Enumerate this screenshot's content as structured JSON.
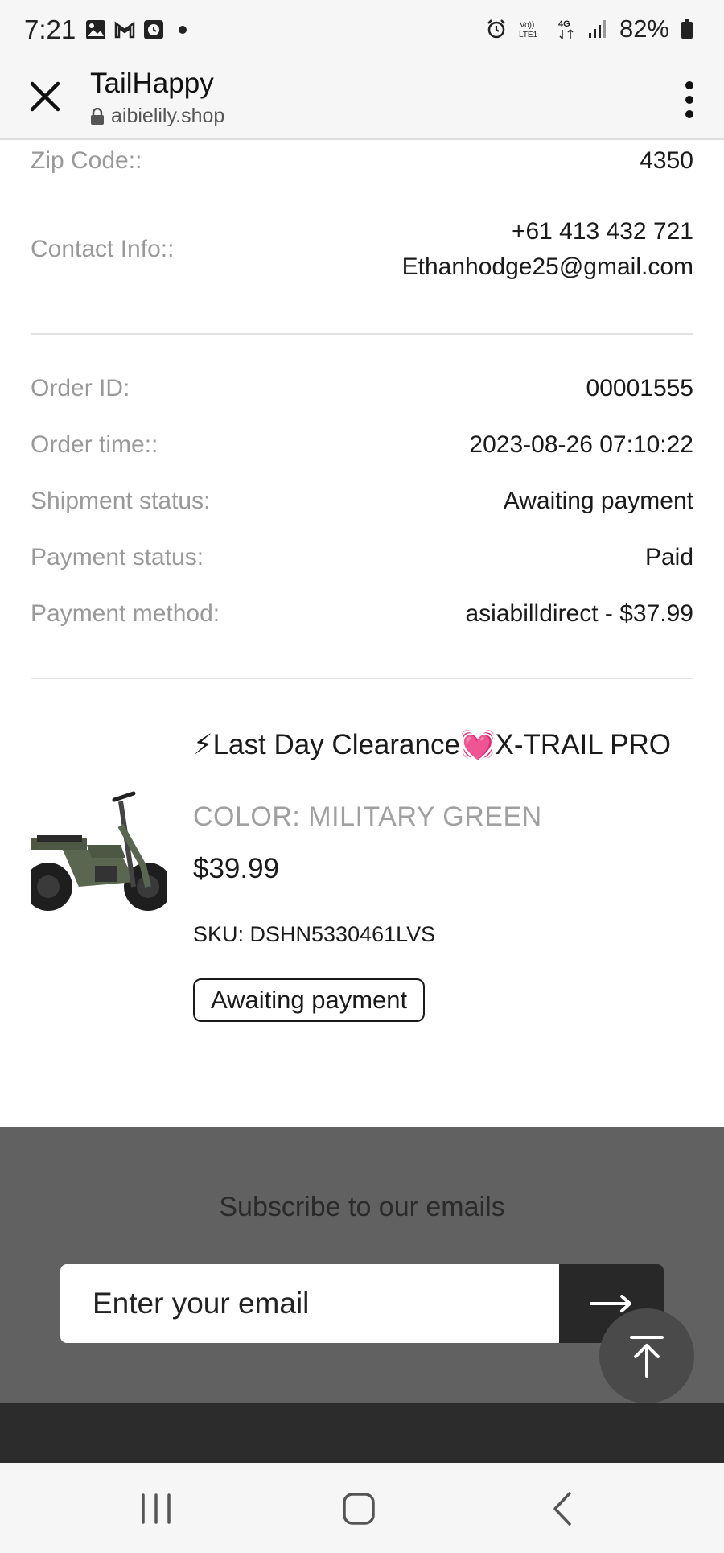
{
  "status_bar": {
    "time": "7:21",
    "battery": "82%",
    "left_icons": [
      "image-icon",
      "gmail-icon",
      "clock-app-icon",
      "notification-dot-icon"
    ],
    "right_icons": [
      "alarm-icon",
      "volte-icon",
      "4g-icon",
      "signal-icon",
      "battery-icon"
    ]
  },
  "browser": {
    "title": "TailHappy",
    "url": "aibielily.shop"
  },
  "order_info": {
    "zip_label": "Zip Code::",
    "zip_value": "4350",
    "contact_label": "Contact Info::",
    "contact_phone": "+61 413 432 721",
    "contact_email": "Ethanhodge25@gmail.com",
    "order_id_label": "Order ID:",
    "order_id_value": "00001555",
    "order_time_label": "Order time::",
    "order_time_value": "2023-08-26 07:10:22",
    "shipment_label": "Shipment status:",
    "shipment_value": "Awaiting payment",
    "payment_status_label": "Payment status:",
    "payment_status_value": "Paid",
    "payment_method_label": "Payment method:",
    "payment_method_value": "asiabilldirect -  $37.99"
  },
  "product": {
    "title": "⚡Last Day Clearance💓X-TRAIL PRO",
    "color": "COLOR: MILITARY GREEN",
    "price": "$39.99",
    "sku": "SKU: DSHN5330461LVS",
    "status": "Awaiting payment"
  },
  "footer": {
    "subscribe_title": "Subscribe to our emails",
    "email_placeholder": "Enter your email"
  },
  "colors": {
    "label_gray": "#999999",
    "footer_bg": "#616161",
    "footer_dark": "#2c2c2c",
    "bike_green": "#5b6650"
  }
}
